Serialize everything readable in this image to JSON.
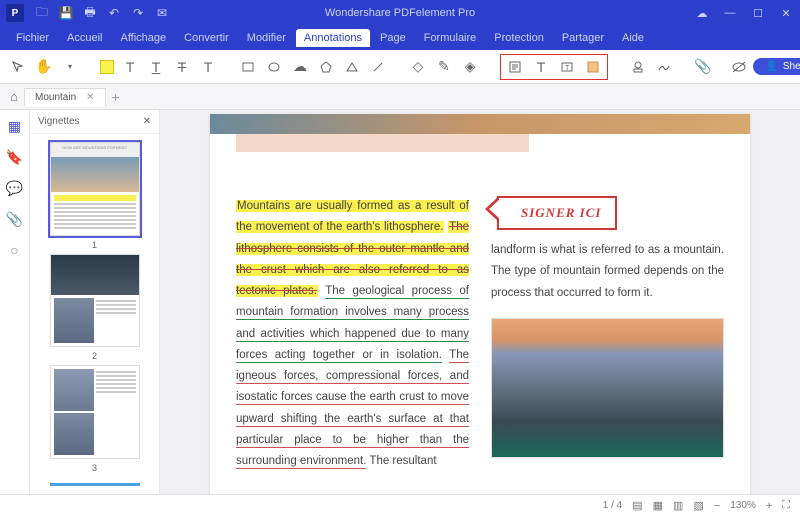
{
  "app": {
    "name": "Wondershare PDFelement Pro"
  },
  "menu": {
    "items": [
      "Fichier",
      "Accueil",
      "Affichage",
      "Convertir",
      "Modifier",
      "Annotations",
      "Page",
      "Formulaire",
      "Protection",
      "Partager",
      "Aide"
    ],
    "active_index": 5
  },
  "user": {
    "name": "Shelley"
  },
  "tab": {
    "title": "Mountain"
  },
  "sidebar": {
    "title": "Vignettes",
    "thumbs": [
      "1",
      "2",
      "3"
    ]
  },
  "doc": {
    "stamp": "SIGNER ICI",
    "left_hl": "Mountains are usually formed as a result of the movement of the earth's lithosphere.",
    "left_strike": "The lithosphere consists of the outer mantle and the crust which are also referred to as tectonic plates.",
    "left_uline_g": "The geological process of mountain formation involves many process and activities which happened due to many forces acting together or in isolation.",
    "left_uline_r": "The igneous forces, compressional forces, and isostatic forces cause the earth crust to move upward shifting the earth's surface at that particular place to be higher than the surrounding environment.",
    "left_tail": " The resultant",
    "right_top": "landform is what is referred to as a mountain. The type of mountain formed depends on the process that occurred to form it."
  },
  "status": {
    "page": "1 / 4",
    "zoom": "130%"
  }
}
